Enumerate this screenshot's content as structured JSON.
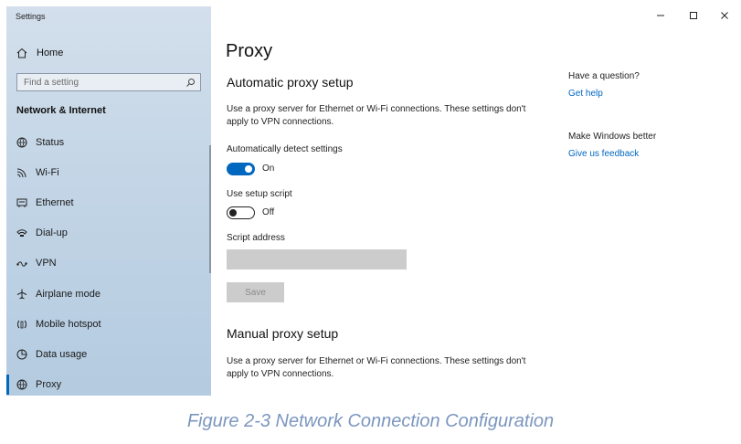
{
  "window": {
    "title": "Settings"
  },
  "sidebar": {
    "home_label": "Home",
    "search_placeholder": "Find a setting",
    "section_title": "Network & Internet",
    "items": [
      {
        "label": "Status",
        "icon": "globe-status-icon"
      },
      {
        "label": "Wi-Fi",
        "icon": "wifi-icon"
      },
      {
        "label": "Ethernet",
        "icon": "ethernet-icon"
      },
      {
        "label": "Dial-up",
        "icon": "dialup-icon"
      },
      {
        "label": "VPN",
        "icon": "vpn-icon"
      },
      {
        "label": "Airplane mode",
        "icon": "airplane-icon"
      },
      {
        "label": "Mobile hotspot",
        "icon": "hotspot-icon"
      },
      {
        "label": "Data usage",
        "icon": "data-usage-icon"
      },
      {
        "label": "Proxy",
        "icon": "globe-icon",
        "selected": true
      }
    ]
  },
  "main": {
    "page_title": "Proxy",
    "automatic": {
      "heading": "Automatic proxy setup",
      "description": "Use a proxy server for Ethernet or Wi-Fi connections. These settings don't apply to VPN connections.",
      "auto_detect_label": "Automatically detect settings",
      "auto_detect_state": "On",
      "auto_detect_on": true,
      "setup_script_label": "Use setup script",
      "setup_script_state": "Off",
      "setup_script_on": false,
      "script_address_label": "Script address",
      "script_address_value": "",
      "save_label": "Save"
    },
    "manual": {
      "heading": "Manual proxy setup",
      "description": "Use a proxy server for Ethernet or Wi-Fi connections. These settings don't apply to VPN connections."
    }
  },
  "right_column": {
    "question_heading": "Have a question?",
    "get_help_link": "Get help",
    "better_heading": "Make Windows better",
    "feedback_link": "Give us feedback"
  },
  "caption": "Figure 2-3 Network Connection Configuration",
  "colors": {
    "accent": "#0067c0",
    "caption": "#7b96bf",
    "sidebar_bg": "#c3d5e6"
  }
}
